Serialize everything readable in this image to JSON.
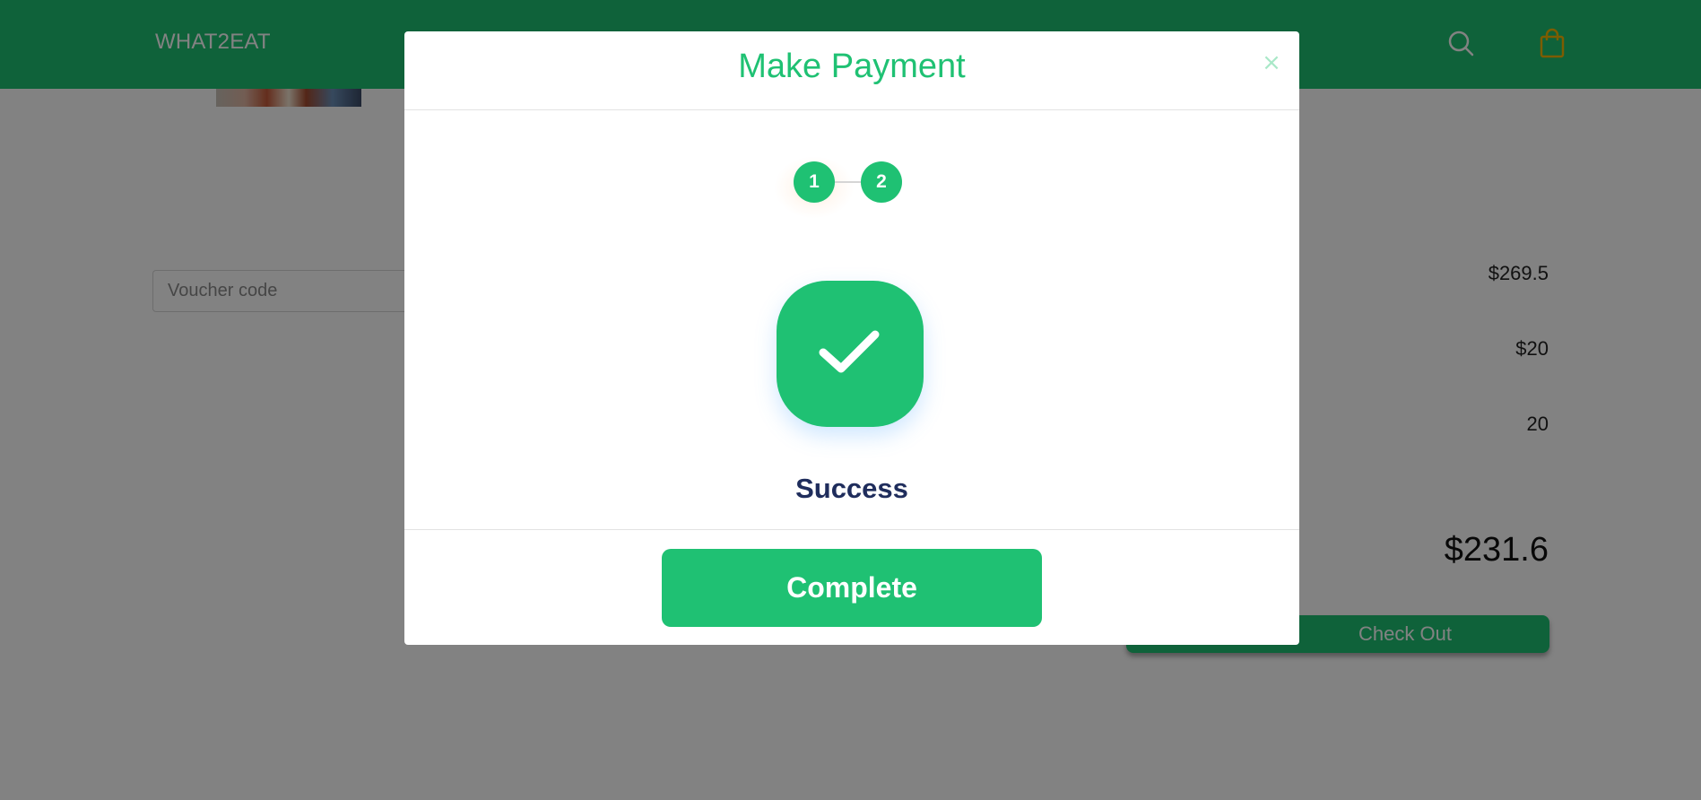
{
  "navbar": {
    "brand": "WHAT2EAT",
    "icons": [
      "search-icon",
      "shopping-bag-icon"
    ],
    "accent_color": "#1fc173",
    "cart_icon_color": "#f5b400"
  },
  "cart": {
    "voucher_placeholder": "Voucher code",
    "subtotal": "$269.5",
    "shipping": "$20",
    "discount": "20",
    "total": "$231.6",
    "checkout_label": "Check Out"
  },
  "modal": {
    "title": "Make Payment",
    "close_symbol": "×",
    "steps": [
      "1",
      "2"
    ],
    "status_icon": "checkmark-icon",
    "status_text": "Success",
    "complete_label": "Complete",
    "title_color": "#1fc173",
    "status_text_color": "#1f2d5c"
  }
}
